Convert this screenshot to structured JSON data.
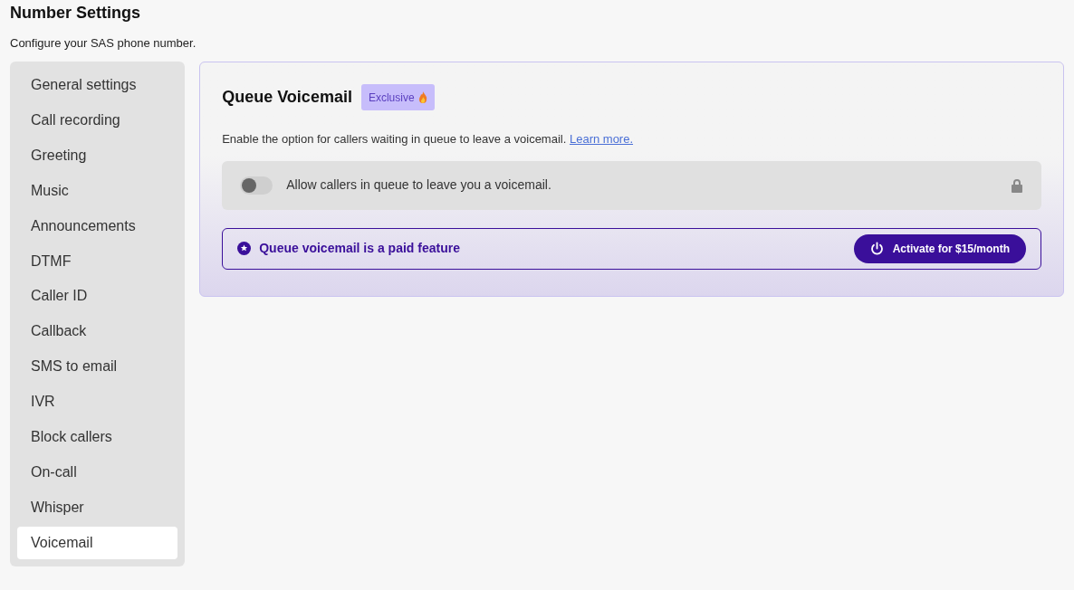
{
  "page": {
    "title": "Number Settings",
    "subtitle": "Configure your SAS phone number."
  },
  "sidebar": {
    "items": [
      {
        "label": "General settings",
        "selected": false
      },
      {
        "label": "Call recording",
        "selected": false
      },
      {
        "label": "Greeting",
        "selected": false
      },
      {
        "label": "Music",
        "selected": false
      },
      {
        "label": "Announcements",
        "selected": false
      },
      {
        "label": "DTMF",
        "selected": false
      },
      {
        "label": "Caller ID",
        "selected": false
      },
      {
        "label": "Callback",
        "selected": false
      },
      {
        "label": "SMS to email",
        "selected": false
      },
      {
        "label": "IVR",
        "selected": false
      },
      {
        "label": "Block callers",
        "selected": false
      },
      {
        "label": "On-call",
        "selected": false
      },
      {
        "label": "Whisper",
        "selected": false
      },
      {
        "label": "Voicemail",
        "selected": true
      }
    ]
  },
  "panel": {
    "title": "Queue Voicemail",
    "badge": "Exclusive",
    "description": "Enable the option for callers waiting in queue to leave a voicemail.",
    "link": "Learn more.",
    "setting": {
      "label": "Allow callers in queue to leave you a voicemail.",
      "on": false,
      "locked": true
    },
    "paid_notice": {
      "text": "Queue voicemail is a paid feature",
      "button": "Activate for $15/month"
    }
  }
}
